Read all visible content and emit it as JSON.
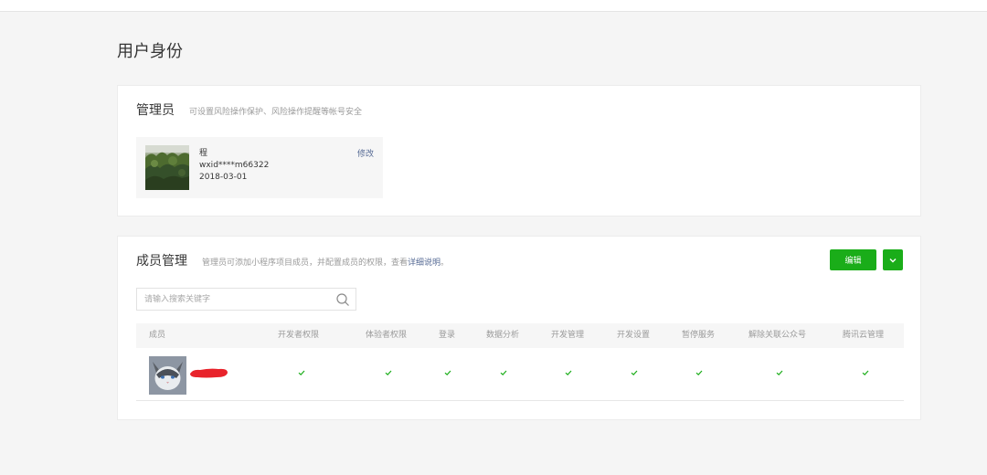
{
  "page": {
    "title": "用户身份"
  },
  "admin_card": {
    "title": "管理员",
    "description": "可设置风险操作保护、风险操作提醒等帐号安全",
    "admin": {
      "name": "程",
      "wxid": "wxid****m66322",
      "date": "2018-03-01",
      "edit_label": "修改"
    }
  },
  "members_card": {
    "title": "成员管理",
    "description": "管理员可添加小程序项目成员，并配置成员的权限，查看",
    "description_link": "详细说明",
    "description_end": "。",
    "edit_button": "编辑",
    "search": {
      "placeholder": "请输入搜索关键字",
      "value": ""
    },
    "columns": [
      "成员",
      "开发者权限",
      "体验者权限",
      "登录",
      "数据分析",
      "开发管理",
      "开发设置",
      "暂停服务",
      "解除关联公众号",
      "腾讯云管理"
    ],
    "rows": [
      {
        "permissions": [
          true,
          true,
          true,
          true,
          true,
          true,
          true,
          true,
          true
        ]
      }
    ]
  },
  "colors": {
    "accent": "#1aad19",
    "link": "#576b95",
    "redaction": "#e8232b"
  },
  "icons": [
    "search-icon",
    "chevron-down-icon",
    "check-icon"
  ]
}
